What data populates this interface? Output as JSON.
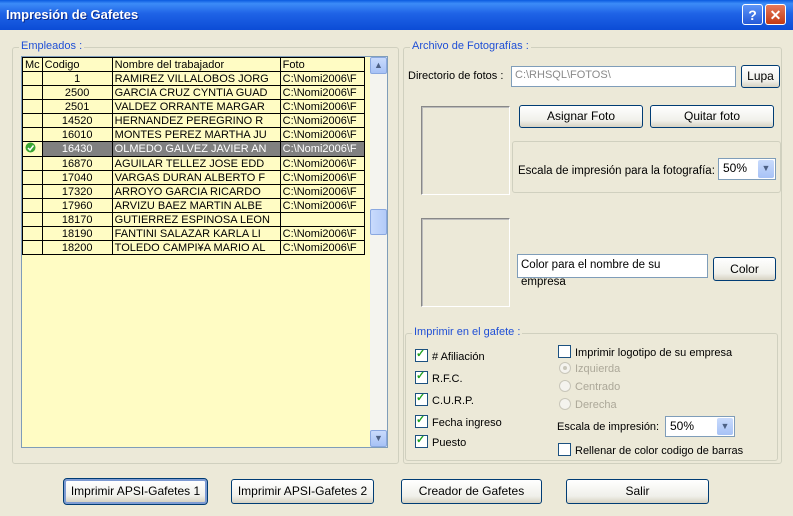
{
  "window": {
    "title": "Impresión de Gafetes",
    "help_glyph": "?",
    "close_glyph": "✕"
  },
  "empleados": {
    "legend": "Empleados :",
    "columns": [
      "Mc",
      "Codigo",
      "Nombre del trabajador",
      "Foto"
    ],
    "rows": [
      {
        "codigo": "1",
        "nombre": "RAMIREZ VILLALOBOS JORG",
        "foto": "C:\\Nomi2006\\F"
      },
      {
        "codigo": "2500",
        "nombre": "GARCIA CRUZ CYNTIA GUAD",
        "foto": "C:\\Nomi2006\\F"
      },
      {
        "codigo": "2501",
        "nombre": "VALDEZ ORRANTE MARGAR",
        "foto": "C:\\Nomi2006\\F"
      },
      {
        "codigo": "14520",
        "nombre": "HERNANDEZ PEREGRINO R",
        "foto": "C:\\Nomi2006\\F"
      },
      {
        "codigo": "16010",
        "nombre": "MONTES PEREZ MARTHA JU",
        "foto": "C:\\Nomi2006\\F"
      },
      {
        "codigo": "16430",
        "nombre": "OLMEDO GALVEZ JAVIER AN",
        "foto": "C:\\Nomi2006\\F",
        "selected": true
      },
      {
        "codigo": "16870",
        "nombre": "AGUILAR TELLEZ JOSE EDD",
        "foto": "C:\\Nomi2006\\F"
      },
      {
        "codigo": "17040",
        "nombre": "VARGAS DURAN ALBERTO F",
        "foto": "C:\\Nomi2006\\F"
      },
      {
        "codigo": "17320",
        "nombre": "ARROYO GARCIA RICARDO",
        "foto": "C:\\Nomi2006\\F"
      },
      {
        "codigo": "17960",
        "nombre": "ARVIZU BAEZ MARTIN ALBE",
        "foto": "C:\\Nomi2006\\F"
      },
      {
        "codigo": "18170",
        "nombre": "GUTIERREZ ESPINOSA LEON",
        "foto": ""
      },
      {
        "codigo": "18190",
        "nombre": "FANTINI SALAZAR KARLA LI",
        "foto": "C:\\Nomi2006\\F"
      },
      {
        "codigo": "18200",
        "nombre": "TOLEDO CAMPI¥A MARIO AL",
        "foto": "C:\\Nomi2006\\F"
      }
    ]
  },
  "archivo": {
    "legend": "Archivo de Fotografías :",
    "dir_label": "Directorio de fotos :",
    "dir_value": "C:\\RHSQL\\FOTOS\\",
    "lupa": "Lupa",
    "asignar": "Asignar Foto",
    "quitar": "Quitar foto",
    "escala_label": "Escala de impresión para la fotografía:",
    "escala_value": "50%",
    "color_empresa_label": "Color para el nombre de su empresa",
    "color_btn": "Color"
  },
  "imprimir": {
    "legend": "Imprimir en el gafete :",
    "afiliacion": "# Afiliación",
    "rfc": "R.F.C.",
    "curp": "C.U.R.P.",
    "fecha": "Fecha ingreso",
    "puesto": "Puesto",
    "logotipo": "Imprimir logotipo de su empresa",
    "izquierda": "Izquierda",
    "centrado": "Centrado",
    "derecha": "Derecha",
    "escala_label": "Escala de impresión:",
    "escala_value": "50%",
    "rellenar": "Rellenar de color codigo de barras"
  },
  "footer": {
    "btn1": "Imprimir APSI-Gafetes 1",
    "btn2": "Imprimir APSI-Gafetes 2",
    "btn3": "Creador de Gafetes",
    "btn4": "Salir"
  }
}
